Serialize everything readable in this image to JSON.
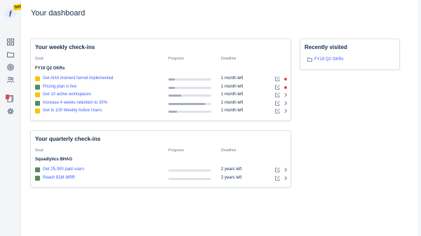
{
  "app": {
    "beta_label": "beta",
    "logo_glyph": "ƒ"
  },
  "sidebar": {
    "items": [
      {
        "icon": "grid-icon"
      },
      {
        "icon": "folder-icon"
      },
      {
        "icon": "target-icon"
      },
      {
        "icon": "users-icon"
      },
      {
        "icon": "notifications-icon"
      },
      {
        "icon": "gear-icon"
      }
    ]
  },
  "page": {
    "title": "Your dashboard"
  },
  "weekly": {
    "title": "Your weekly check-ins",
    "columns": {
      "goal": "Goal",
      "progress": "Progress",
      "deadline": "Deadline"
    },
    "group": "FY19 Q2 OKRs",
    "rows": [
      {
        "name": "Get AHA moment funnel implemented",
        "progress": 0.15,
        "deadline": "1 month left",
        "icon_color": "#f6c700",
        "indicator": "dot"
      },
      {
        "name": "Pricing plan is live",
        "progress": 0.15,
        "deadline": "1 month left",
        "icon_color": "#5b8a5b",
        "indicator": "dot"
      },
      {
        "name": "Get 10 active workspaces",
        "progress": 0.3,
        "deadline": "1 month left",
        "icon_color": "#f6c700",
        "indicator": "chevron"
      },
      {
        "name": "Increase 4 weeks retention to 30%",
        "progress": 0.85,
        "deadline": "1 month left",
        "icon_color": "#5b8a5b",
        "indicator": "chevron"
      },
      {
        "name": "Get to 100 Weekly Active Users",
        "progress": 0.2,
        "deadline": "1 month left",
        "icon_color": "#f6c700",
        "indicator": "chevron"
      }
    ]
  },
  "quarterly": {
    "title": "Your quarterly check-ins",
    "columns": {
      "goal": "Goal",
      "progress": "Progress",
      "deadline": "Deadline"
    },
    "group": "Squadlytics BHAG",
    "rows": [
      {
        "name": "Get 25,000 paid users",
        "progress": 0.0,
        "deadline": "2 years left",
        "icon_color": "#5b8a5b",
        "indicator": "chevron"
      },
      {
        "name": "Reach $1M MRR",
        "progress": 0.0,
        "deadline": "2 years left",
        "icon_color": "#5b8a5b",
        "indicator": "chevron"
      }
    ]
  },
  "recent": {
    "title": "Recently visited",
    "items": [
      {
        "label": "FY19 Q2 OKRs",
        "icon": "folder-icon"
      }
    ]
  }
}
